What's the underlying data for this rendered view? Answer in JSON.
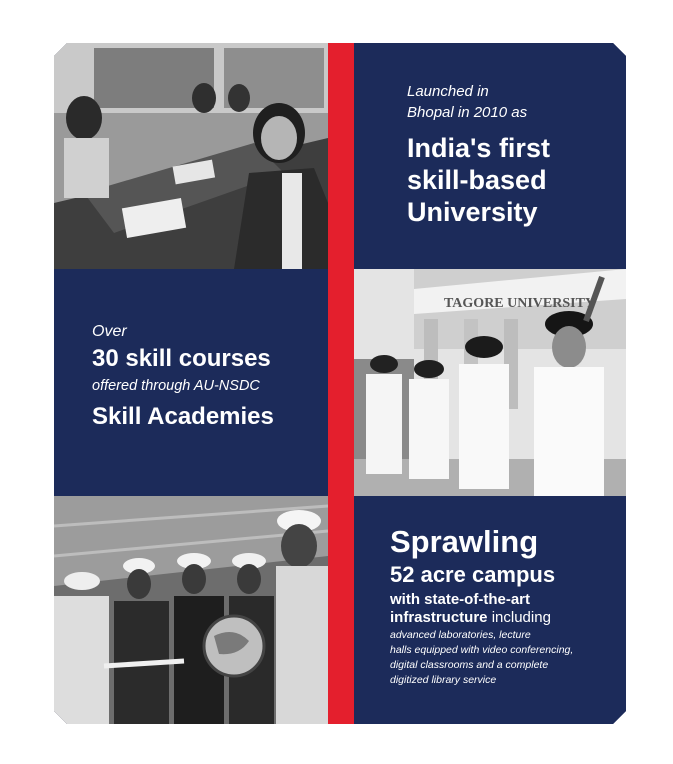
{
  "colors": {
    "navy": "#1c2b5a",
    "red": "#e41f2d",
    "text": "#ffffff"
  },
  "images": [
    {
      "name": "students-at-library-table-photo"
    },
    {
      "name": "ncc-cadets-tagore-university-photo",
      "sign_text": "TAGORE UNIVERSITY"
    },
    {
      "name": "students-in-hard-hats-with-globe-photo"
    }
  ],
  "panel1": {
    "line1": "Launched in",
    "line2": "Bhopal in 2010 as",
    "headline1": "India's first",
    "headline2": "skill-based",
    "headline3": "University"
  },
  "panel2": {
    "line1": "Over",
    "headline1": "30 skill courses",
    "line2": "offered through AU-NSDC",
    "headline2": "Skill Academies"
  },
  "panel3": {
    "headline1": "Sprawling",
    "headline2": "52 acre campus",
    "bold1": "with state-of-the-art",
    "bold2": "infrastructure",
    "bold2_suffix": " including",
    "small1": "advanced laboratories, lecture",
    "small2": "halls equipped with video conferencing,",
    "small3": "digital classrooms and a complete",
    "small4": "digitized library service"
  }
}
